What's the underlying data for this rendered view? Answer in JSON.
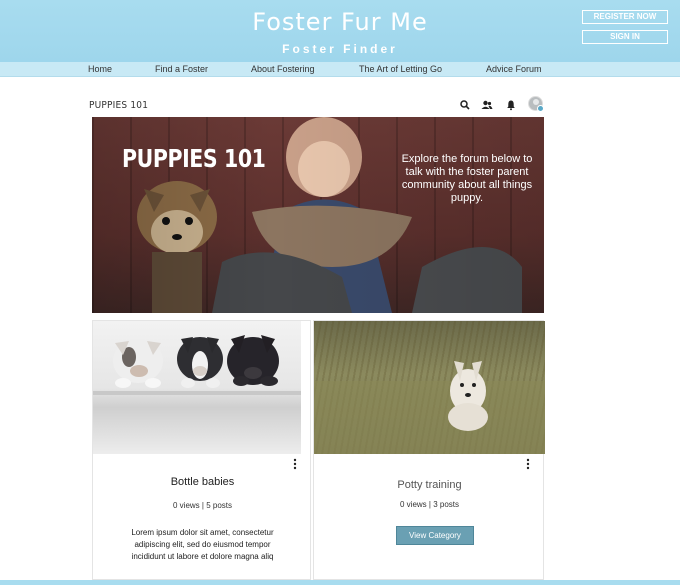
{
  "header": {
    "title": "Foster Fur Me",
    "subtitle": "Foster Finder",
    "register_label": "REGISTER NOW",
    "signin_label": "SIGN IN"
  },
  "nav": {
    "items": [
      {
        "label": "Home"
      },
      {
        "label": "Find a Foster"
      },
      {
        "label": "About Fostering"
      },
      {
        "label": "The Art of Letting Go"
      },
      {
        "label": "Advice Forum"
      }
    ]
  },
  "forum": {
    "title": "PUPPIES 101",
    "icons": [
      "search-icon",
      "members-icon",
      "notifications-icon",
      "avatar"
    ]
  },
  "hero": {
    "title": "PUPPIES 101",
    "text": "Explore the forum below to talk with the foster parent community about all things puppy."
  },
  "cards": [
    {
      "title": "Bottle babies",
      "meta": "0 views | 5 posts",
      "description": "Lorem ipsum dolor sit amet, consectetur adipiscing elit, sed do eiusmod tempor incididunt ut labore et dolore magna aliq"
    },
    {
      "title": "Potty training",
      "meta": "0 views | 3 posts",
      "button_label": "View Category"
    }
  ],
  "colors": {
    "header_bg": "#a8dcef",
    "nav_bg": "#c8e9f5",
    "button_bg": "#6aa0b3"
  }
}
